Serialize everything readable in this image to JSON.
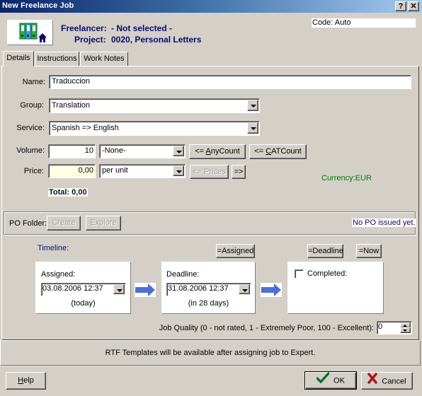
{
  "window": {
    "title": "New Freelance Job",
    "help_button": "?",
    "close_button": "✕"
  },
  "header": {
    "freelancer_label": "Freelancer:",
    "freelancer_value": "- Not selected -",
    "project_label": "Project:",
    "project_value": "0020, Personal Letters",
    "code_text": "Code: Auto",
    "icon": "binders-home-icon"
  },
  "tabs": [
    {
      "label": "Details",
      "active": true
    },
    {
      "label": "Instructions",
      "active": false
    },
    {
      "label": "Work Notes",
      "active": false
    }
  ],
  "details": {
    "name_label": "Name:",
    "name_value": "Traduccion",
    "group_label": "Group:",
    "group_value": "Translation",
    "service_label": "Service:",
    "service_value": "Spanish => English",
    "volume_label": "Volume:",
    "volume_value": "10",
    "volume_unit": "-None-",
    "anycount_prefix": "<= ",
    "anycount_ul": "A",
    "anycount_rest": "nyCount",
    "catcount_prefix": "<= ",
    "catcount_ul": "C",
    "catcount_rest": "ATCount",
    "price_label": "Price:",
    "price_value": "0,00",
    "price_unit": "per unit",
    "prices_button": "<= Prices",
    "forward_button": "=>",
    "currency": "Currency:EUR",
    "total": "Total: 0,00"
  },
  "po": {
    "label": "PO Folder:",
    "create_button": "Create",
    "explore_button": "Explore",
    "status": "No PO issued yet."
  },
  "timeline": {
    "title": "Timeline:",
    "assigned_button": "=Assigned",
    "deadline_button": "=Deadline",
    "now_button": "=Now",
    "assigned_label": "Assigned:",
    "assigned_value": "03.08.2006 12:37",
    "assigned_note": "(today)",
    "deadline_label": "Deadline:",
    "deadline_value": "31.08.2006 12:37",
    "deadline_note": "(in 28 days)",
    "completed_label": "Completed:",
    "completed_checked": false,
    "quality_label": "Job Quality (0 - not rated, 1 - Extremely Poor, 100 - Excellent):",
    "quality_value": "0"
  },
  "footer": {
    "rtf_note": "RTF Templates will be available after assigning job to Expert.",
    "help_ul": "H",
    "help_rest": "elp",
    "ok_button": "OK",
    "cancel_button": "Cancel"
  },
  "colors": {
    "header_text": "#0a0a6e",
    "currency": "#008000",
    "total_bg": "#ffffe1",
    "arrow": "#4a6fe0"
  }
}
